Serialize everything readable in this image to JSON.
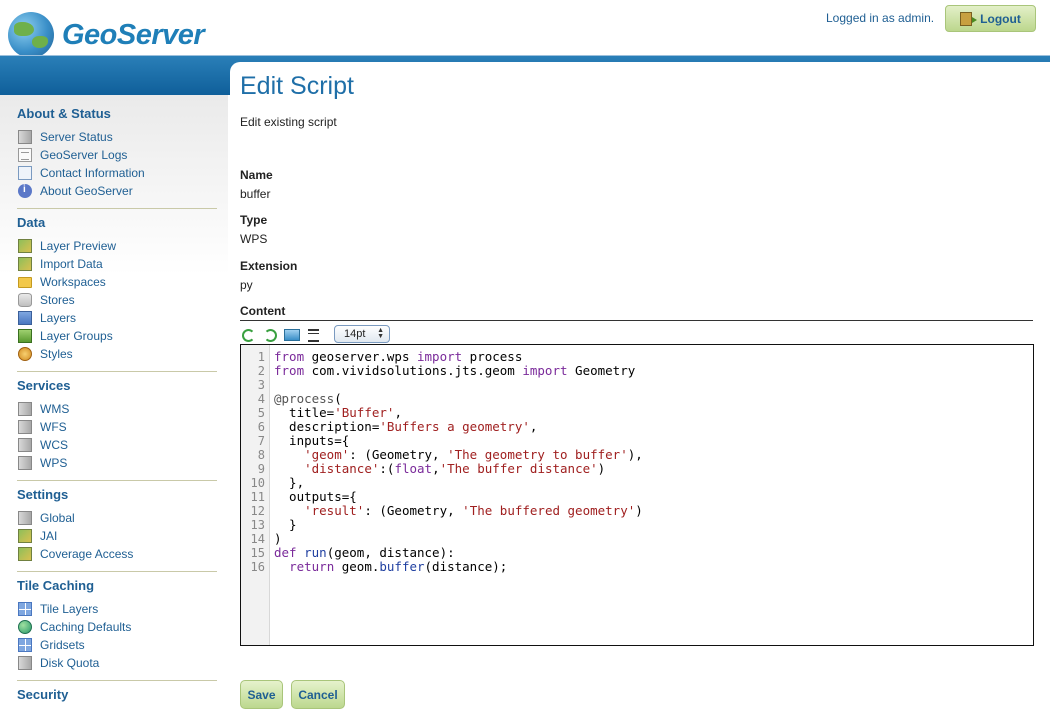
{
  "header": {
    "brand": "GeoServer",
    "login_status": "Logged in as admin.",
    "logout_label": "Logout"
  },
  "sidebar": {
    "sections": [
      {
        "title": "About & Status",
        "items": [
          {
            "label": "Server Status",
            "icon": "server-status-icon"
          },
          {
            "label": "GeoServer Logs",
            "icon": "logs-icon"
          },
          {
            "label": "Contact Information",
            "icon": "contact-card-icon"
          },
          {
            "label": "About GeoServer",
            "icon": "info-icon"
          }
        ]
      },
      {
        "title": "Data",
        "items": [
          {
            "label": "Layer Preview",
            "icon": "map-preview-icon"
          },
          {
            "label": "Import Data",
            "icon": "import-map-icon"
          },
          {
            "label": "Workspaces",
            "icon": "folder-icon"
          },
          {
            "label": "Stores",
            "icon": "database-icon"
          },
          {
            "label": "Layers",
            "icon": "layer-icon"
          },
          {
            "label": "Layer Groups",
            "icon": "layer-group-icon"
          },
          {
            "label": "Styles",
            "icon": "palette-icon"
          }
        ]
      },
      {
        "title": "Services",
        "items": [
          {
            "label": "WMS",
            "icon": "server-icon"
          },
          {
            "label": "WFS",
            "icon": "server-icon"
          },
          {
            "label": "WCS",
            "icon": "server-icon"
          },
          {
            "label": "WPS",
            "icon": "server-icon"
          }
        ]
      },
      {
        "title": "Settings",
        "items": [
          {
            "label": "Global",
            "icon": "server-icon"
          },
          {
            "label": "JAI",
            "icon": "map-preview-icon"
          },
          {
            "label": "Coverage Access",
            "icon": "map-preview-icon"
          }
        ]
      },
      {
        "title": "Tile Caching",
        "items": [
          {
            "label": "Tile Layers",
            "icon": "grid-icon"
          },
          {
            "label": "Caching Defaults",
            "icon": "globe-icon"
          },
          {
            "label": "Gridsets",
            "icon": "grid-icon"
          },
          {
            "label": "Disk Quota",
            "icon": "server-icon"
          }
        ]
      },
      {
        "title": "Security",
        "items": []
      }
    ]
  },
  "page": {
    "title": "Edit Script",
    "description": "Edit existing script",
    "fields": {
      "name_label": "Name",
      "name_value": "buffer",
      "type_label": "Type",
      "type_value": "WPS",
      "extension_label": "Extension",
      "extension_value": "py",
      "content_label": "Content"
    },
    "editor": {
      "font_size": "14pt",
      "lines": [
        "from geoserver.wps import process",
        "from com.vividsolutions.jts.geom import Geometry",
        "",
        "@process(",
        "  title='Buffer',",
        "  description='Buffers a geometry',",
        "  inputs={",
        "    'geom': (Geometry, 'The geometry to buffer'),",
        "    'distance':(float,'The buffer distance')",
        "  },",
        "  outputs={",
        "    'result': (Geometry, 'The buffered geometry')",
        "  }",
        ")",
        "def run(geom, distance):",
        "  return geom.buffer(distance);"
      ]
    },
    "save_label": "Save",
    "cancel_label": "Cancel"
  }
}
